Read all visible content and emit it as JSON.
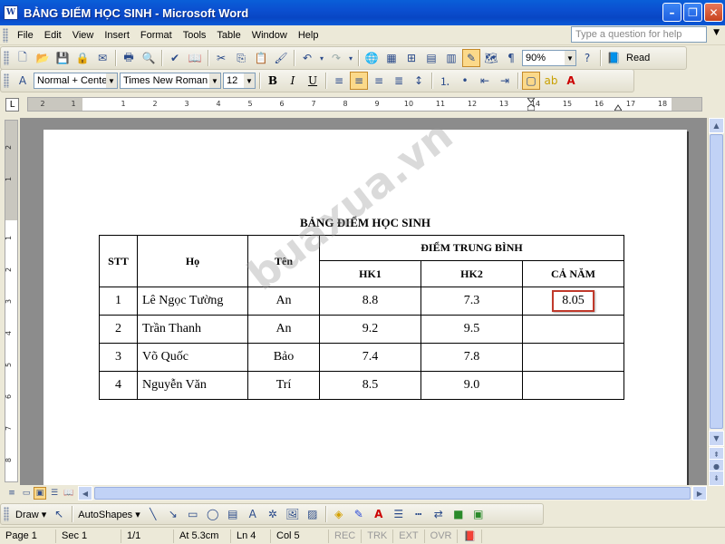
{
  "window": {
    "title": "BẢNG ĐIỂM HỌC SINH - Microsoft Word",
    "icon_label": "W",
    "minimize": "–",
    "restore": "❐",
    "close": "✕"
  },
  "menu": {
    "items": [
      "File",
      "Edit",
      "View",
      "Insert",
      "Format",
      "Tools",
      "Table",
      "Window",
      "Help"
    ],
    "help_placeholder": "Type a question for help"
  },
  "standard_toolbar": {
    "zoom": "90%",
    "read_label": "Read"
  },
  "formatting_toolbar": {
    "style": "Normal + Cente",
    "font": "Times New Roman",
    "size": "12",
    "bold": "B",
    "italic": "I",
    "underline": "U"
  },
  "ruler": {
    "numbers": [
      "2",
      "1",
      "1",
      "2",
      "3",
      "4",
      "5",
      "6",
      "7",
      "8",
      "9",
      "10",
      "11",
      "12",
      "13",
      "14",
      "15",
      "16",
      "17",
      "18"
    ],
    "vertical_numbers": [
      "2",
      "1",
      "1",
      "2",
      "3",
      "4",
      "5",
      "6",
      "7",
      "8"
    ]
  },
  "document": {
    "title": "BẢNG ĐIỂM HỌC SINH",
    "watermark": "buaxua.vn",
    "headers": {
      "stt": "STT",
      "ho": "Họ",
      "ten": "Tên",
      "dtb": "ĐIỂM TRUNG BÌNH",
      "hk1": "HK1",
      "hk2": "HK2",
      "canam": "CẢ NĂM"
    },
    "rows": [
      {
        "stt": "1",
        "ho": "Lê Ngọc Tường",
        "ten": "An",
        "hk1": "8.8",
        "hk2": "7.3",
        "canam": "8.05"
      },
      {
        "stt": "2",
        "ho": "Trần Thanh",
        "ten": "An",
        "hk1": "9.2",
        "hk2": "9.5",
        "canam": ""
      },
      {
        "stt": "3",
        "ho": "Võ Quốc",
        "ten": "Bảo",
        "hk1": "7.4",
        "hk2": "7.8",
        "canam": ""
      },
      {
        "stt": "4",
        "ho": "Nguyễn Văn",
        "ten": "Trí",
        "hk1": "8.5",
        "hk2": "9.0",
        "canam": ""
      }
    ]
  },
  "drawing_toolbar": {
    "draw": "Draw ▾",
    "autoshapes": "AutoShapes ▾"
  },
  "status": {
    "page": "Page 1",
    "sec": "Sec 1",
    "pages": "1/1",
    "at": "At 5.3cm",
    "ln": "Ln 4",
    "col": "Col 5",
    "rec": "REC",
    "trk": "TRK",
    "ext": "EXT",
    "ovr": "OVR"
  }
}
